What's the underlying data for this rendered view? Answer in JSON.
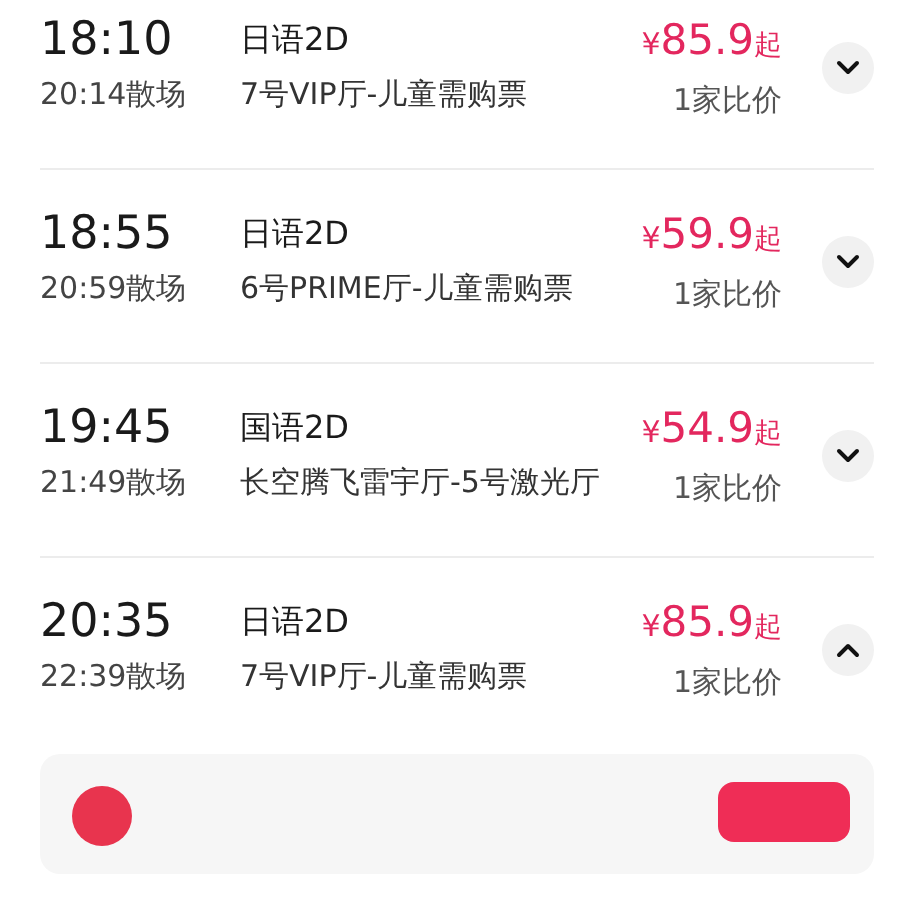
{
  "showings": [
    {
      "start": "18:10",
      "end": "20:14散场",
      "language": "日语2D",
      "hall": "7号VIP厅-儿童需购票",
      "currency": "¥",
      "price": "85.9",
      "price_suffix": "起",
      "compare": "1家比价",
      "expanded": false
    },
    {
      "start": "18:55",
      "end": "20:59散场",
      "language": "日语2D",
      "hall": "6号PRIME厅-儿童需购票",
      "currency": "¥",
      "price": "59.9",
      "price_suffix": "起",
      "compare": "1家比价",
      "expanded": false
    },
    {
      "start": "19:45",
      "end": "21:49散场",
      "language": "国语2D",
      "hall": "长空腾飞雷宇厅-5号激光厅",
      "currency": "¥",
      "price": "54.9",
      "price_suffix": "起",
      "compare": "1家比价",
      "expanded": false
    },
    {
      "start": "20:35",
      "end": "22:39散场",
      "language": "日语2D",
      "hall": "7号VIP厅-儿童需购票",
      "currency": "¥",
      "price": "85.9",
      "price_suffix": "起",
      "compare": "1家比价",
      "expanded": true
    }
  ]
}
